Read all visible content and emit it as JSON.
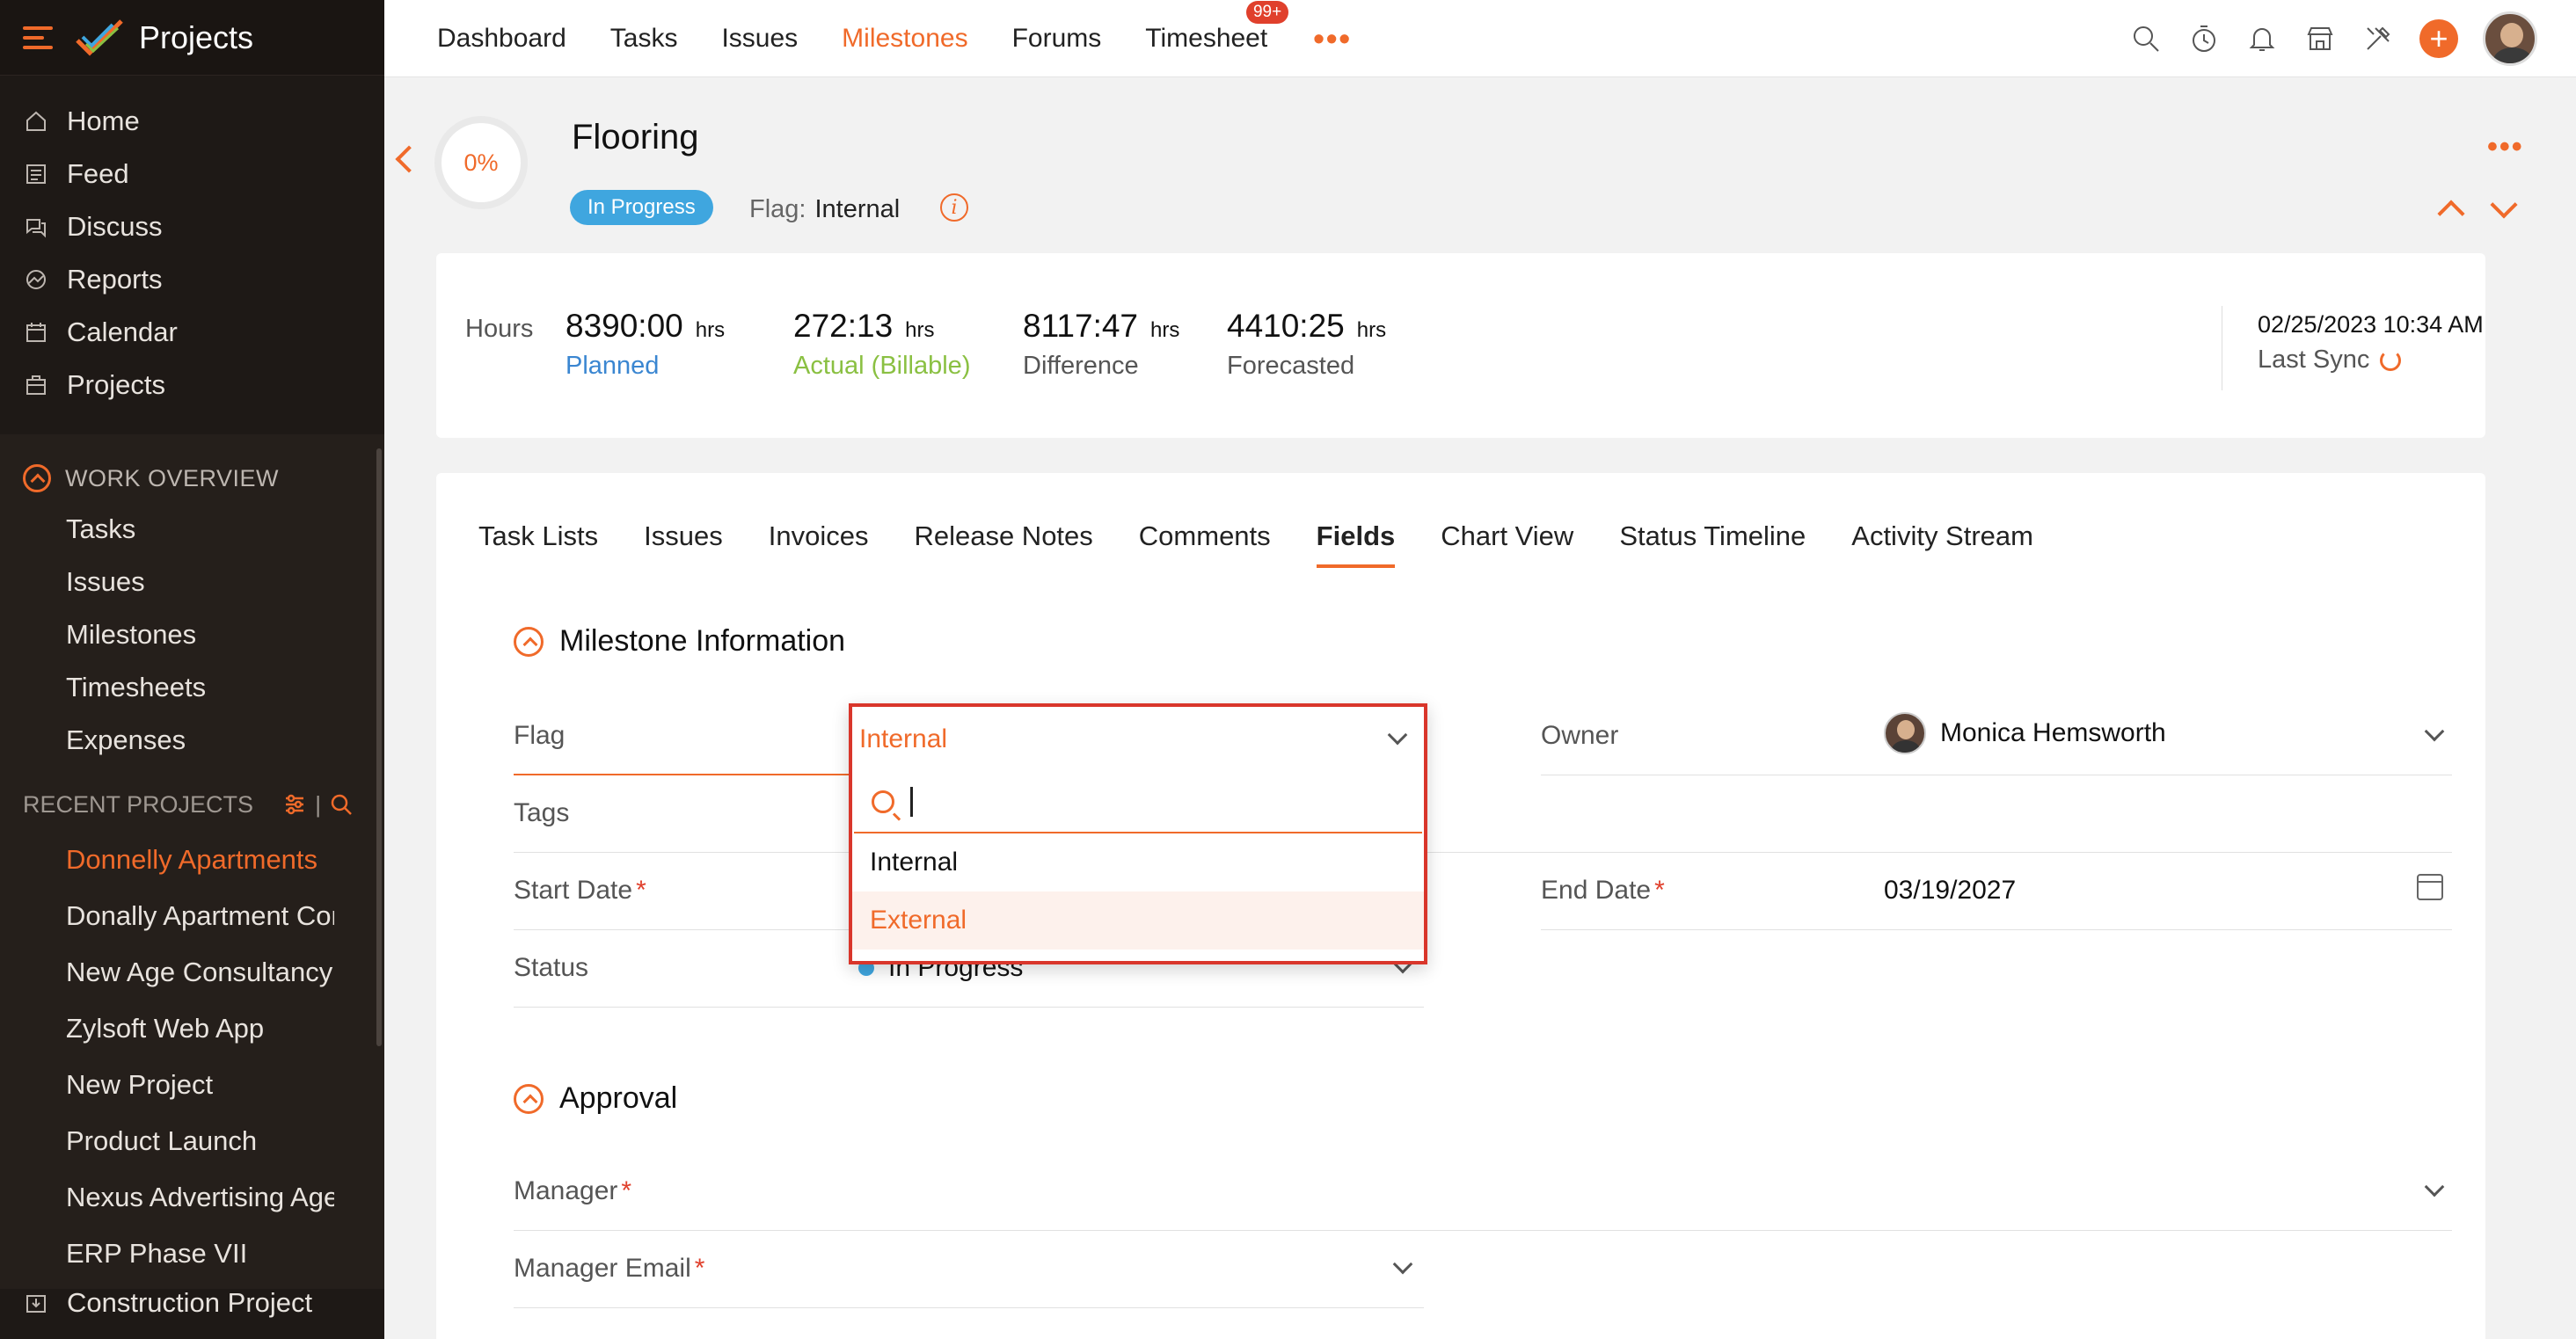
{
  "app": {
    "title": "Projects"
  },
  "sidebar": {
    "main": [
      {
        "label": "Home",
        "icon": "home-icon"
      },
      {
        "label": "Feed",
        "icon": "feed-icon"
      },
      {
        "label": "Discuss",
        "icon": "discuss-icon"
      },
      {
        "label": "Reports",
        "icon": "reports-icon"
      },
      {
        "label": "Calendar",
        "icon": "calendar-icon"
      },
      {
        "label": "Projects",
        "icon": "projects-icon"
      }
    ],
    "work_overview": {
      "title": "WORK OVERVIEW",
      "items": [
        "Tasks",
        "Issues",
        "Milestones",
        "Timesheets",
        "Expenses"
      ]
    },
    "recent": {
      "title": "RECENT PROJECTS",
      "items": [
        "Donnelly Apartments",
        "Donally Apartment Construction",
        "New Age Consultancy",
        "Zylsoft Web App",
        "New Project",
        "Product Launch",
        "Nexus Advertising Agency",
        "ERP Phase VII",
        "Construction Project"
      ]
    }
  },
  "topnav": {
    "tabs": [
      "Dashboard",
      "Tasks",
      "Issues",
      "Milestones",
      "Forums",
      "Timesheet"
    ],
    "active": "Milestones",
    "timesheet_badge": "99+"
  },
  "milestone": {
    "progress": "0%",
    "title": "Flooring",
    "status": "In Progress",
    "flag_label": "Flag:",
    "flag_value": "Internal"
  },
  "hours": {
    "label": "Hours",
    "unit": "hrs",
    "planned": {
      "value": "8390:00",
      "caption": "Planned"
    },
    "actual": {
      "value": "272:13",
      "caption": "Actual (Billable)"
    },
    "difference": {
      "value": "8117:47",
      "caption": "Difference"
    },
    "forecasted": {
      "value": "4410:25",
      "caption": "Forecasted"
    },
    "sync_datetime": "02/25/2023 10:34 AM",
    "sync_label": "Last Sync"
  },
  "tabs": [
    "Task Lists",
    "Issues",
    "Invoices",
    "Release Notes",
    "Comments",
    "Fields",
    "Chart View",
    "Status Timeline",
    "Activity Stream"
  ],
  "active_tab": "Fields",
  "sections": {
    "info_title": "Milestone Information",
    "approval_title": "Approval"
  },
  "fields": {
    "flag": {
      "label": "Flag",
      "value": "Internal"
    },
    "owner": {
      "label": "Owner",
      "value": "Monica Hemsworth"
    },
    "tags": {
      "label": "Tags"
    },
    "start_date": {
      "label": "Start Date"
    },
    "end_date": {
      "label": "End Date",
      "value": "03/19/2027"
    },
    "status": {
      "label": "Status",
      "value": "In Progress"
    },
    "manager": {
      "label": "Manager"
    },
    "manager_email": {
      "label": "Manager Email"
    }
  },
  "dropdown": {
    "selected": "Internal",
    "options": [
      "Internal",
      "External"
    ],
    "hovered": "External"
  },
  "colors": {
    "accent": "#f06a2a",
    "sidebar": "#1e1916",
    "status": "#3fa6df",
    "highlight": "#d9362b"
  }
}
